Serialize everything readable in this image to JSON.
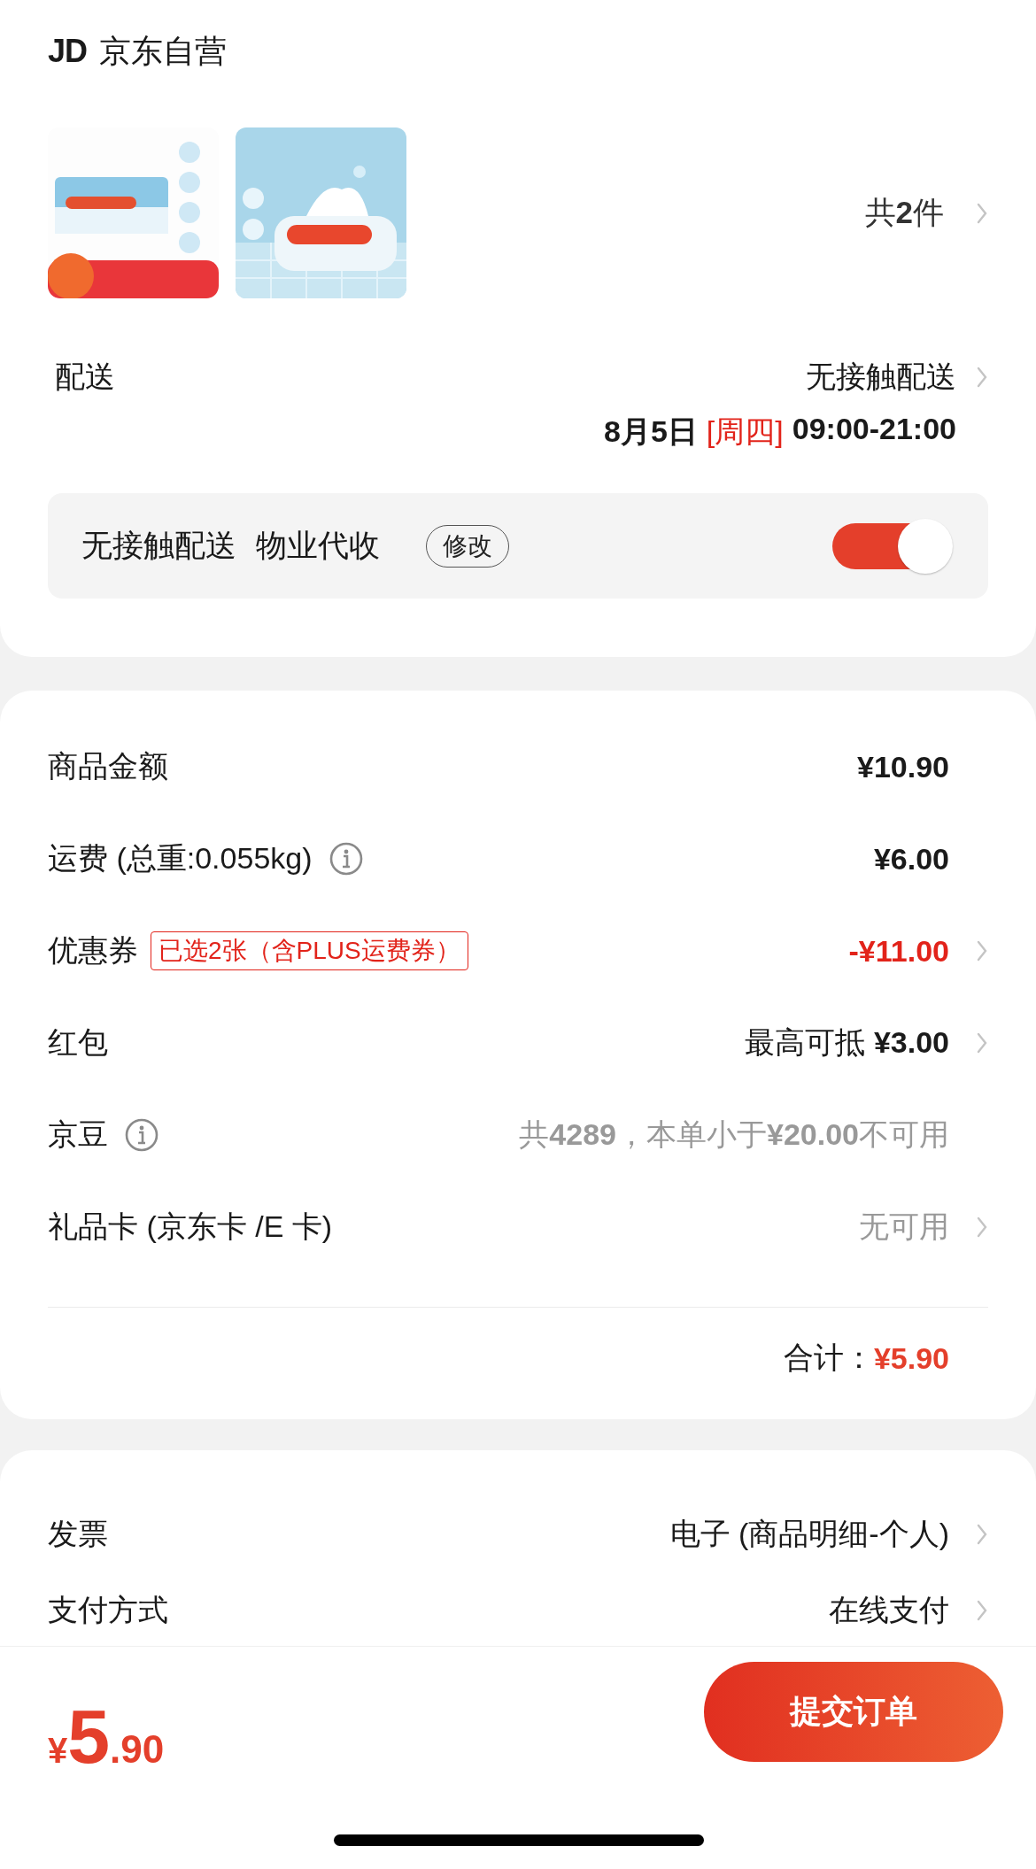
{
  "shop": {
    "logo": "JD",
    "name": "京东自营"
  },
  "products": {
    "count": "共**2**件"
  },
  "delivery": {
    "label": "配送",
    "method": "无接触配送",
    "date": "8月5日",
    "weekday": "[周四]",
    "time": "09:00-21:00"
  },
  "contactless": {
    "texts": [
      "无接触配送",
      "物业代收"
    ],
    "edit_button": "修改",
    "on": true
  },
  "summary": {
    "rows": [
      {
        "label": "商品金额",
        "value": "¥10.90",
        "kind": "strong",
        "info": false,
        "chevron": false
      },
      {
        "label": "运费 (总重:0.055kg)",
        "value": "¥6.00",
        "kind": "strong",
        "info": true,
        "chevron": false
      },
      {
        "label": "优惠券",
        "tag": "已选2张（含PLUS运费券）",
        "value": "-¥11.00",
        "kind": "red",
        "info": false,
        "chevron": true
      },
      {
        "label": "红包",
        "value": "最高可抵 **¥3.00**",
        "kind": "normal",
        "info": false,
        "chevron": true
      },
      {
        "label": "京豆",
        "value": "共**4289**，本单小于**¥20.00**不可用",
        "kind": "muted",
        "info": true,
        "chevron": false
      },
      {
        "label": "礼品卡 (京东卡 /E 卡)",
        "value": "无可用",
        "kind": "muted",
        "info": false,
        "chevron": true
      }
    ],
    "total_label": "合计：",
    "total": "¥5.90"
  },
  "other": {
    "rows": [
      {
        "label": "发票",
        "value": "电子 (商品明细-个人)",
        "chevron": true
      },
      {
        "label": "支付方式",
        "value": "在线支付",
        "chevron": true
      }
    ]
  },
  "footer": {
    "currency": "¥",
    "price_int": "5",
    "price_dec": ".90",
    "submit_button": "提交订单"
  }
}
